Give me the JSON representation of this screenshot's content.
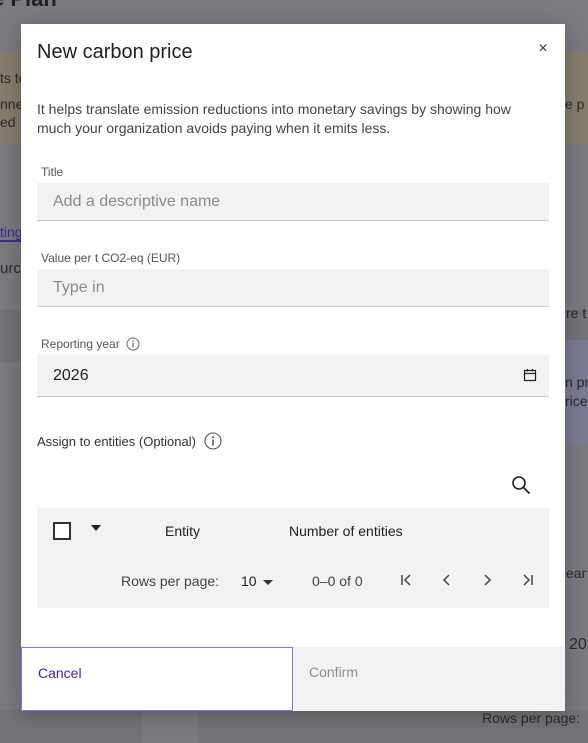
{
  "background": {
    "page_title_fragment": "e Plan",
    "banner_fragments": [
      "ts to",
      "nne",
      " ed",
      "e p"
    ],
    "tab_fragment": "ting",
    "left_fragment": "urce",
    "right_fragment_1": "re t",
    "right_fragment_2": "n pr",
    "right_fragment_3": "rice",
    "right_fragment_4": "ear",
    "right_fragment_5": "20",
    "bottom_rows_label": "Rows per page:"
  },
  "modal": {
    "title": "New carbon price",
    "close_symbol": "×",
    "description": "It helps translate emission reductions into monetary savings by showing how much your organization avoids paying when it emits less.",
    "fields": {
      "title": {
        "label": "Title",
        "placeholder": "Add a descriptive name",
        "value": ""
      },
      "value": {
        "label": "Value per t CO2-eq (EUR)",
        "placeholder": "Type in",
        "value": ""
      },
      "year": {
        "label": "Reporting year",
        "value": "2026"
      }
    },
    "assign_label": "Assign to entities (Optional)",
    "table": {
      "columns": [
        "Entity",
        "Number of entities"
      ],
      "rows_per_page_label": "Rows per page:",
      "rows_per_page": "10",
      "range": "0–0 of 0"
    },
    "cancel_label": "Cancel",
    "confirm_label": "Confirm"
  }
}
